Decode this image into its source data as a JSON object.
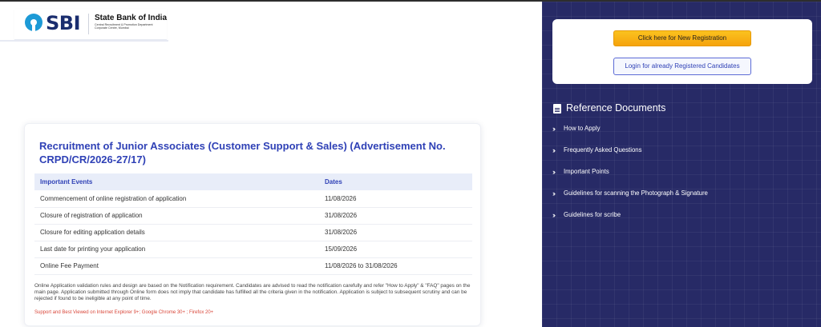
{
  "header": {
    "logo_text": "SBI",
    "bank_name": "State Bank of India",
    "bank_subtitle": "Central Recruitment & Promotion Department Corporate Centre, Mumbai"
  },
  "main": {
    "title": "Recruitment of Junior Associates (Customer Support & Sales) (Advertisement No. CRPD/CR/2026-27/17)",
    "table": {
      "headers": [
        "Important Events",
        "Dates"
      ],
      "rows": [
        [
          "Commencement of online registration of application",
          "11/08/2026"
        ],
        [
          "Closure of registration of application",
          "31/08/2026"
        ],
        [
          "Closure for editing application details",
          "31/08/2026"
        ],
        [
          "Last date for printing your application",
          "15/09/2026"
        ],
        [
          "Online Fee Payment",
          "11/08/2026 to 31/08/2026"
        ]
      ]
    },
    "note": "Online Application validation rules and design are based on the Notification requirement. Candidates are advised to read the notification carefully and refer \"How to Apply\" & \"FAQ\" pages on the main page. Application submitted through Online form does not imply that candidate has fulfilled all the criteria given in the notification. Application is subject to subsequent scrutiny and can be rejected if found to be ineligible at any point of time.",
    "support": "Support and Best Viewed on Internet Explorer 9+; Google Chrome 30+ ; Firefox 20+"
  },
  "sidebar": {
    "new_registration_label": "Click here for New Registration",
    "login_label": "Login for already Registered Candidates",
    "reference_title": "Reference Documents",
    "links": [
      "How to Apply",
      "Frequently Asked Questions",
      "Important Points",
      "Guidelines for scanning the Photograph & Signature",
      "Guidelines for scribe"
    ]
  },
  "colors": {
    "panel_bg": "#272a66",
    "accent_blue": "#2f41b6",
    "button_orange": "#f5a30d",
    "warning_red": "#d9473a"
  },
  "icons": [
    "sbi-logo-icon",
    "document-icon",
    "chevron-right-icon"
  ]
}
